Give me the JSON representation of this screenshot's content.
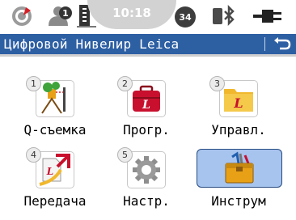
{
  "statusbar": {
    "time": "10:18",
    "icons": [
      "compass-icon",
      "user-profile-1-icon",
      "level-staff-icon",
      "battery-34-icon",
      "bluetooth-device-icon",
      "power-plug-icon"
    ],
    "battery_value": "34"
  },
  "header": {
    "title": "Цифровой Нивелир Leica",
    "back_icon": "back-arrow-icon"
  },
  "apps": [
    {
      "number": "1",
      "label": "Q-съемка",
      "icon": "survey-icon"
    },
    {
      "number": "2",
      "label": "Прогр.",
      "icon": "programs-case-icon"
    },
    {
      "number": "3",
      "label": "Управл.",
      "icon": "manage-folder-icon"
    },
    {
      "number": "4",
      "label": "Передача",
      "icon": "transfer-icon"
    },
    {
      "number": "5",
      "label": "Настр.",
      "icon": "settings-gear-icon"
    },
    {
      "number": "",
      "label": "Инструм",
      "icon": "toolbox-icon",
      "selected": true
    }
  ],
  "colors": {
    "title_bar": "#2d5fa3",
    "selection": "#a7c4ee",
    "leica_red": "#c8102e",
    "folder_yellow": "#f1b82d"
  }
}
